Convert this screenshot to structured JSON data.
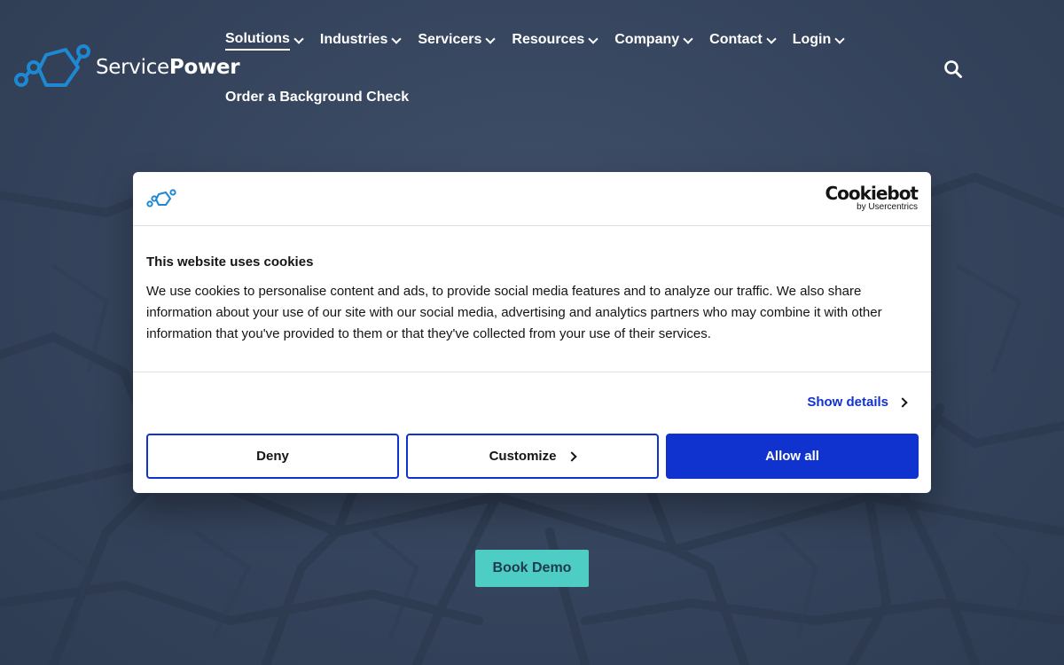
{
  "brand": {
    "name_light": "Service",
    "name_bold": "Power",
    "accent": "#1e88d2"
  },
  "nav": {
    "items": [
      {
        "label": "Solutions"
      },
      {
        "label": "Industries"
      },
      {
        "label": "Servicers"
      },
      {
        "label": "Resources"
      },
      {
        "label": "Company"
      },
      {
        "label": "Contact"
      },
      {
        "label": "Login"
      }
    ],
    "secondary_label": "Order a Background Check",
    "search_icon": "search-icon"
  },
  "hero": {
    "cta_label": "Book Demo",
    "cta_color": "#4ecdc4"
  },
  "cookie_dialog": {
    "provider_main": "Cookiebot",
    "provider_sub": "by Usercentrics",
    "title": "This website uses cookies",
    "body": "We use cookies to personalise content and ads, to provide social media features and to analyze our traffic. We also share information about your use of our site with our social media, advertising and analytics partners who may combine it with other information that you've provided to them or that they've collected from your use of their services.",
    "show_details_label": "Show details",
    "deny_label": "Deny",
    "customize_label": "Customize",
    "allow_label": "Allow all",
    "button_color": "#1032cf"
  }
}
